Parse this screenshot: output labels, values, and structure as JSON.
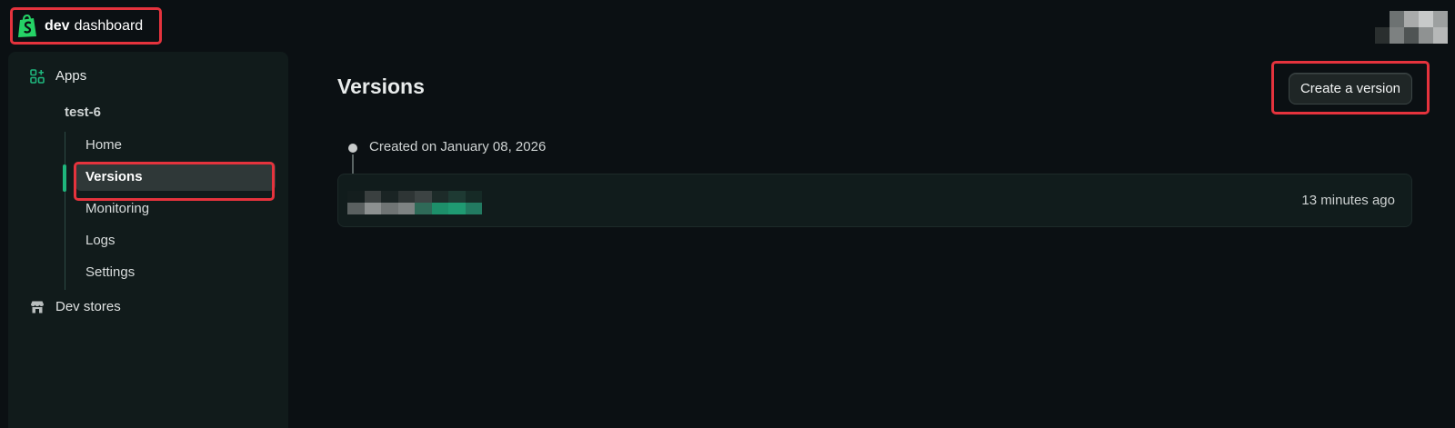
{
  "brand": {
    "bold": "dev",
    "text": "dashboard"
  },
  "sidebar": {
    "apps_label": "Apps",
    "app_name": "test-6",
    "items": [
      {
        "label": "Home"
      },
      {
        "label": "Versions",
        "active": true
      },
      {
        "label": "Monitoring"
      },
      {
        "label": "Logs"
      },
      {
        "label": "Settings"
      }
    ],
    "dev_stores_label": "Dev stores"
  },
  "main": {
    "title": "Versions",
    "create_button": "Create a version",
    "timeline": {
      "created_text": "Created on January 08, 2026"
    },
    "version": {
      "time": "13 minutes ago"
    }
  },
  "colors": {
    "accent": "#1fb57c",
    "highlight": "#e5333d",
    "background": "#0b1013",
    "sidebar": "#111b1b"
  },
  "icons": {
    "logo": "shopify-bag-icon",
    "apps": "apps-grid-plus-icon",
    "dev_stores": "storefront-icon"
  }
}
